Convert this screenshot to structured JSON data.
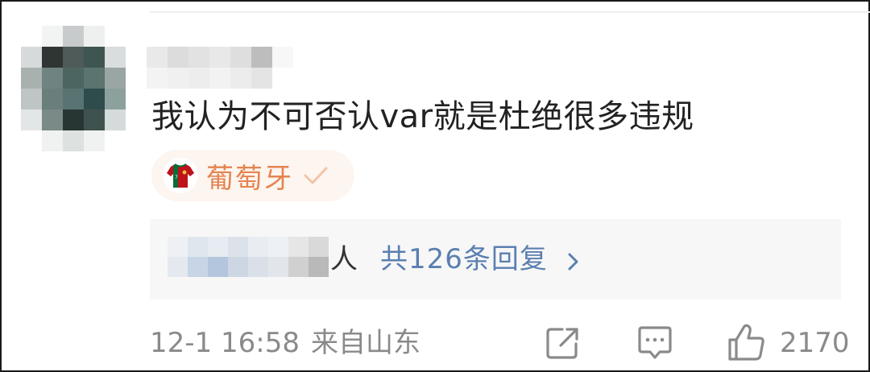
{
  "comment": {
    "text": "我认为不可否认var就是杜绝很多违规",
    "team_badge": {
      "name": "葡萄牙",
      "icon": "jersey-icon",
      "color": "#e4844f"
    },
    "replies": {
      "person_suffix": "人",
      "count_label": "共126条回复",
      "chevron_icon": "chevron-right-icon"
    },
    "meta": {
      "time": "12-1 16:58",
      "location": "来自山东"
    },
    "actions": {
      "share_icon": "share-icon",
      "comment_icon": "comment-icon",
      "like_icon": "like-icon",
      "like_count": "2170"
    }
  },
  "colors": {
    "accent_link": "#5b7fb0",
    "badge_text": "#e4844f",
    "muted": "#8a8a8a"
  }
}
